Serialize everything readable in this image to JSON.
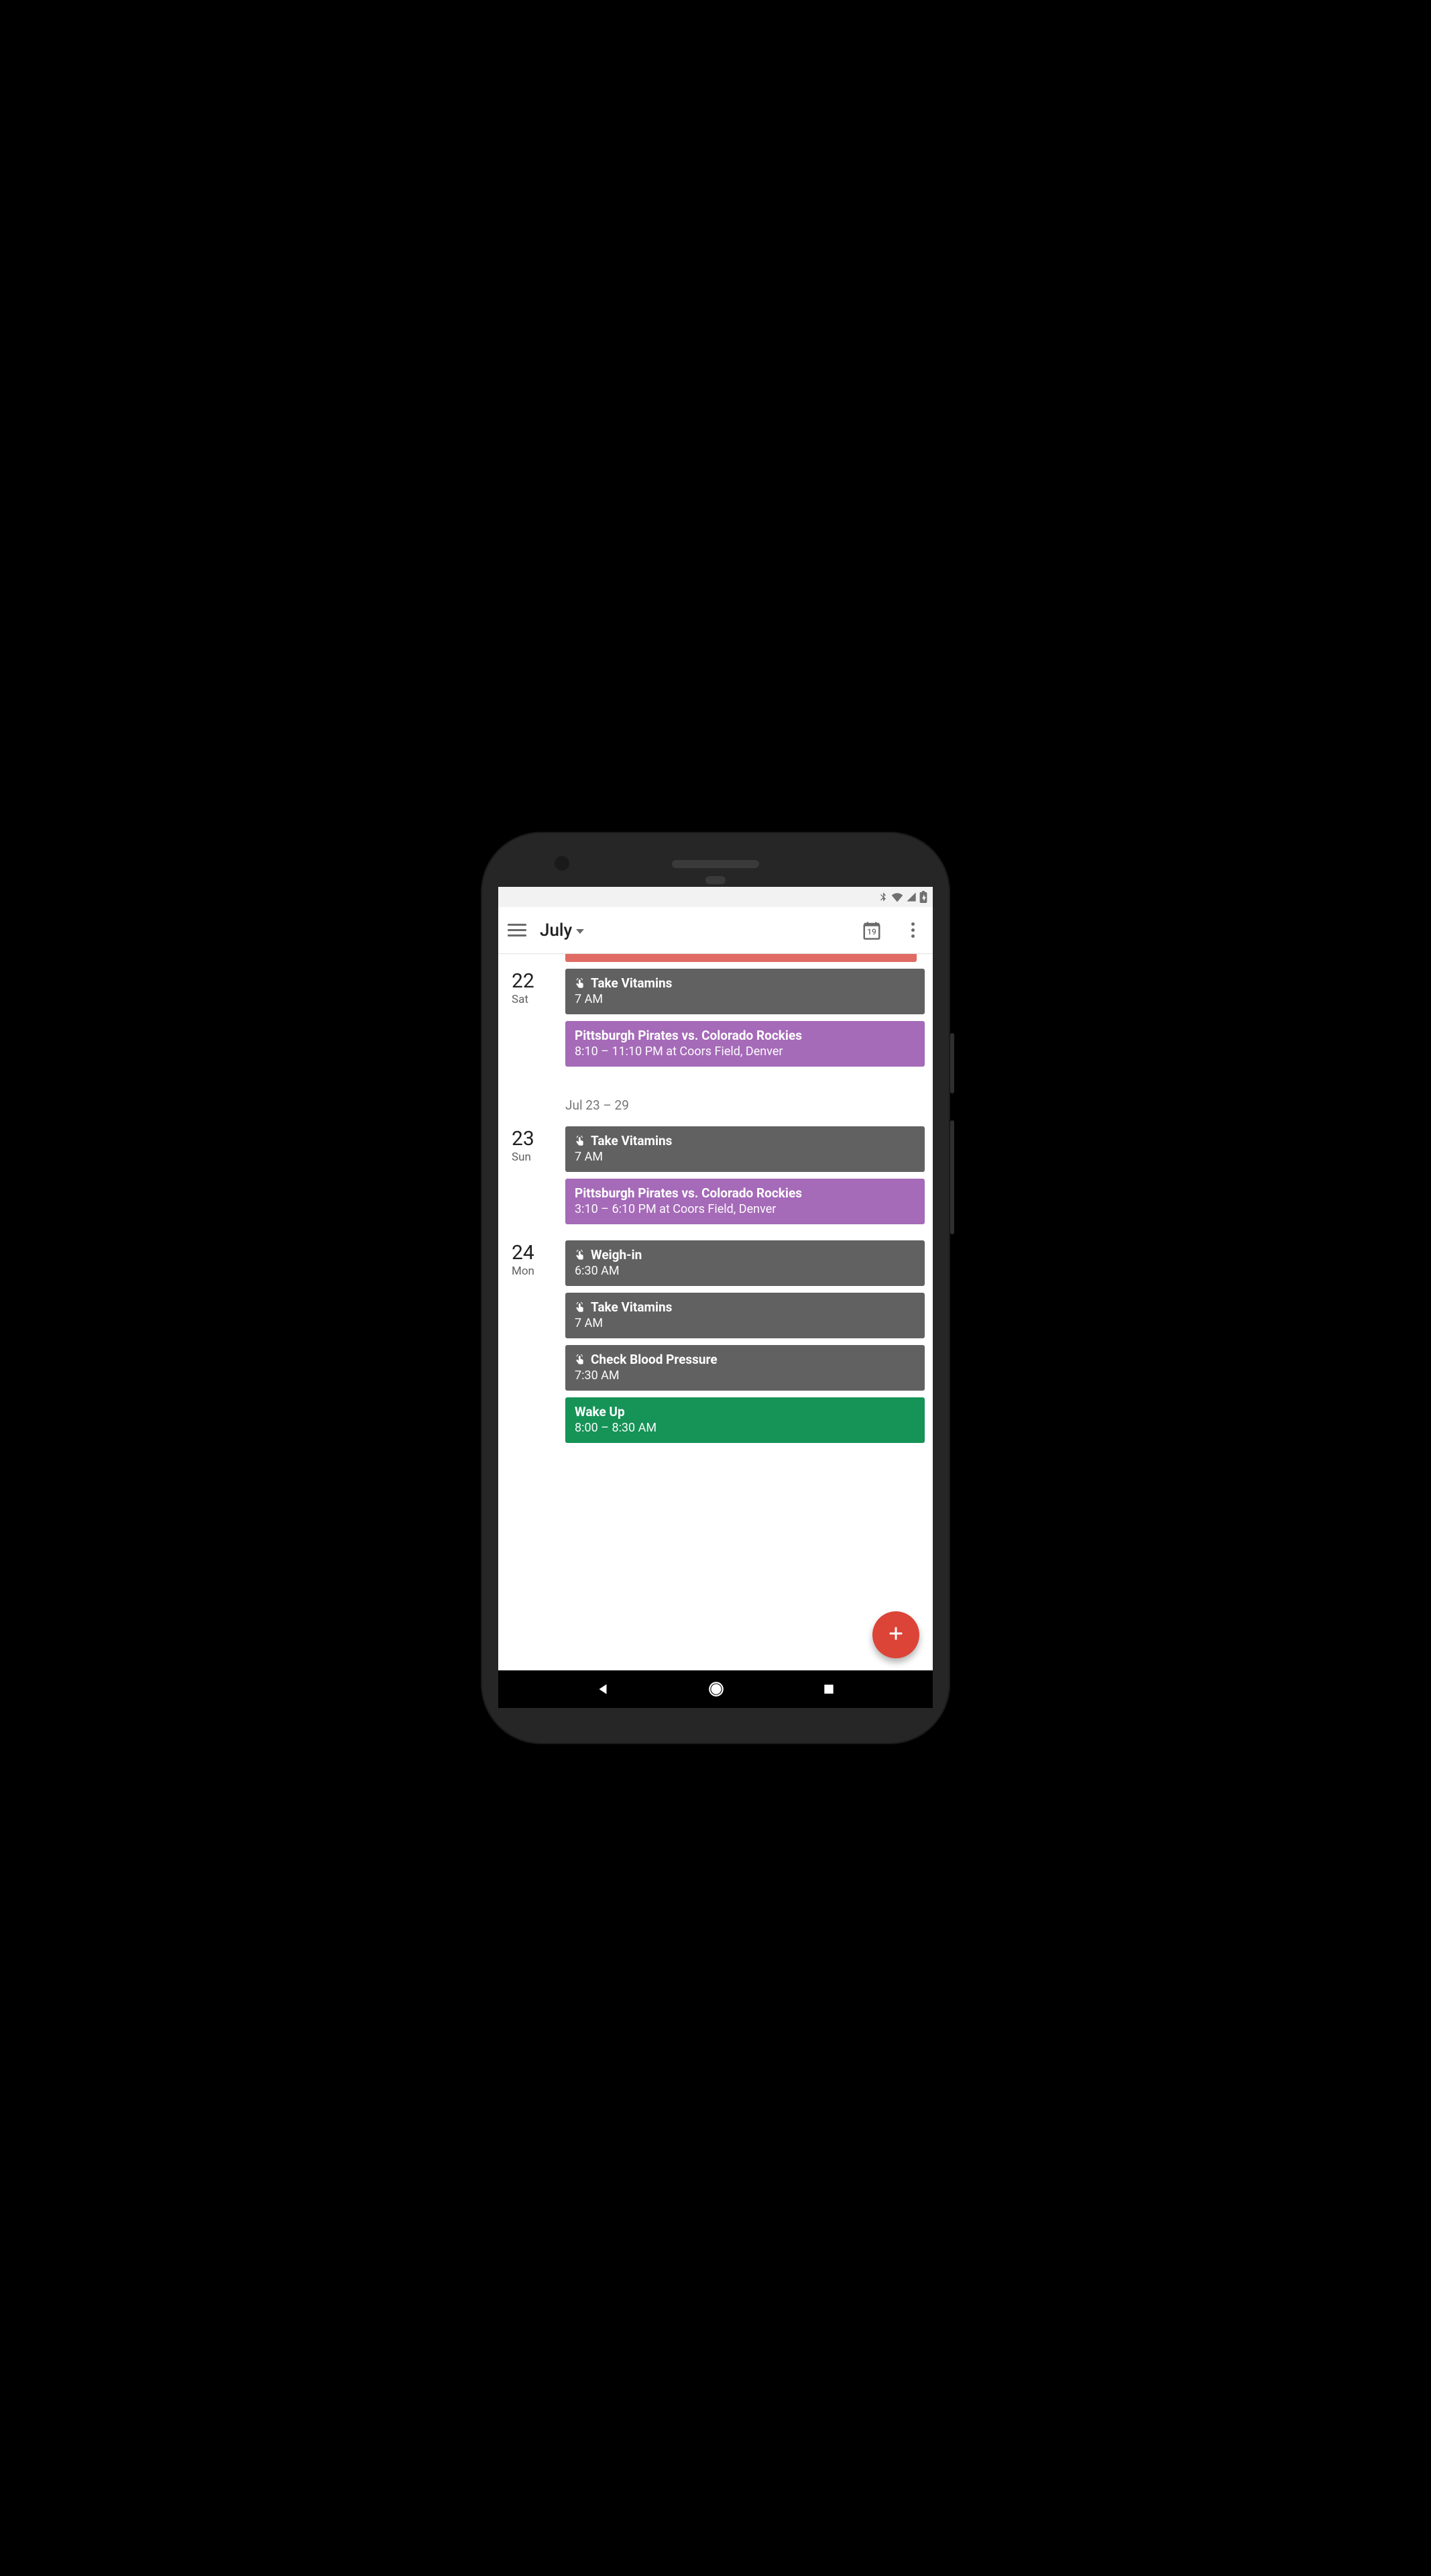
{
  "header": {
    "month_label": "July",
    "today_day": "19"
  },
  "week_divider": "Jul 23 – 29",
  "days": [
    {
      "num": "22",
      "dow": "Sat",
      "events": [
        {
          "color": "gray",
          "hasIcon": true,
          "title": "Take Vitamins",
          "sub": "7 AM"
        },
        {
          "color": "purple",
          "hasIcon": false,
          "title": "Pittsburgh Pirates vs. Colorado Rockies",
          "sub": "8:10 – 11:10 PM at Coors Field, Denver"
        }
      ]
    },
    {
      "num": "23",
      "dow": "Sun",
      "events": [
        {
          "color": "gray",
          "hasIcon": true,
          "title": "Take Vitamins",
          "sub": "7 AM"
        },
        {
          "color": "purple",
          "hasIcon": false,
          "title": "Pittsburgh Pirates vs. Colorado Rockies",
          "sub": "3:10 – 6:10 PM at Coors Field, Denver"
        }
      ]
    },
    {
      "num": "24",
      "dow": "Mon",
      "events": [
        {
          "color": "gray",
          "hasIcon": true,
          "title": "Weigh-in",
          "sub": "6:30 AM"
        },
        {
          "color": "gray",
          "hasIcon": true,
          "title": "Take Vitamins",
          "sub": "7 AM"
        },
        {
          "color": "gray",
          "hasIcon": true,
          "title": "Check Blood Pressure",
          "sub": "7:30 AM"
        },
        {
          "color": "green",
          "hasIcon": false,
          "title": "Wake Up",
          "sub": "8:00 – 8:30 AM"
        }
      ]
    }
  ]
}
